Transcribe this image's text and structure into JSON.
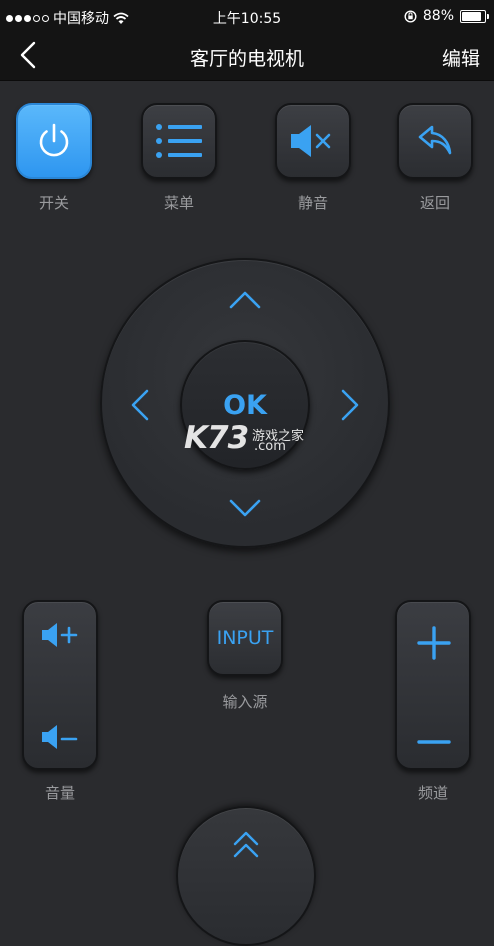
{
  "status_bar": {
    "carrier": "中国移动",
    "time": "上午10:55",
    "battery": "88%",
    "signal_icon": "signal-dots-icon",
    "wifi_icon": "wifi-icon",
    "rotation_lock_icon": "rotation-lock-icon"
  },
  "nav": {
    "title": "客厅的电视机",
    "edit_label": "编辑",
    "back_icon": "chevron-left-icon"
  },
  "top_buttons": [
    {
      "label": "开关",
      "icon": "power-icon"
    },
    {
      "label": "菜单",
      "icon": "menu-list-icon"
    },
    {
      "label": "静音",
      "icon": "mute-icon"
    },
    {
      "label": "返回",
      "icon": "return-arrow-icon"
    }
  ],
  "dpad": {
    "ok_label": "OK",
    "arrows": [
      "chevron-up-icon",
      "chevron-down-icon",
      "chevron-left-icon",
      "chevron-right-icon"
    ]
  },
  "volume": {
    "label": "音量",
    "up_icon": "volume-up-icon",
    "down_icon": "volume-down-icon"
  },
  "input": {
    "button_text": "INPUT",
    "label": "输入源"
  },
  "channel": {
    "label": "频道",
    "up_icon": "plus-icon",
    "down_icon": "minus-icon"
  },
  "watermark": {
    "brand": "K73",
    "text": "游戏之家",
    "domain": ".com"
  },
  "bottom_button": {
    "icon": "double-chevron-up-icon"
  },
  "colors": {
    "accent": "#3aa2f2",
    "power_button": "#48aaf6",
    "background": "#2a2b2e",
    "bar_background": "#141414",
    "label_text": "#9a9b9e"
  }
}
